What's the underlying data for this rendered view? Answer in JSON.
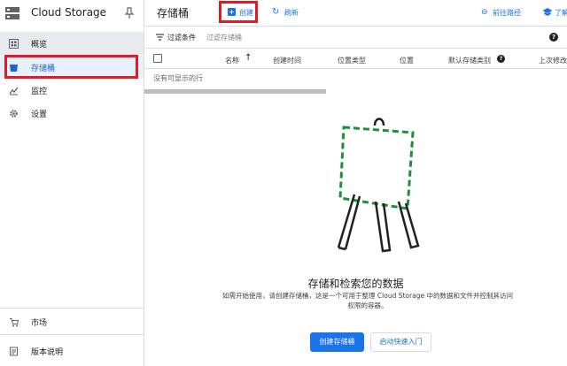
{
  "sidebar": {
    "product_title": "Cloud Storage",
    "items": [
      {
        "label": "概览",
        "icon": "dashboard-icon"
      },
      {
        "label": "存储桶",
        "icon": "bucket-icon"
      },
      {
        "label": "监控",
        "icon": "chart-icon"
      },
      {
        "label": "设置",
        "icon": "gear-icon"
      }
    ],
    "footer_items": [
      {
        "label": "市场",
        "icon": "cart-icon"
      },
      {
        "label": "版本说明",
        "icon": "notes-icon"
      }
    ]
  },
  "header": {
    "title": "存储桶",
    "create_label": "创建",
    "refresh_label": "刷新",
    "goto_label": "前往路径",
    "learn_label": "了解"
  },
  "filter": {
    "label": "过滤条件",
    "placeholder": "过滤存储桶"
  },
  "table": {
    "columns": [
      "名称",
      "创建时间",
      "位置类型",
      "位置",
      "默认存储类别",
      "上次修改"
    ],
    "empty_text": "没有可显示的行"
  },
  "empty_state": {
    "title": "存储和检索您的数据",
    "description": "如需开始使用，请创建存储桶，这是一个可用于整理 Cloud Storage 中的数据和文件并控制其访问权限的容器。",
    "primary_button": "创建存储桶",
    "secondary_button": "启动快速入门"
  },
  "colors": {
    "accent": "#1a73e8",
    "highlight": "#e01b24",
    "illustration_green": "#1e8e3e"
  }
}
